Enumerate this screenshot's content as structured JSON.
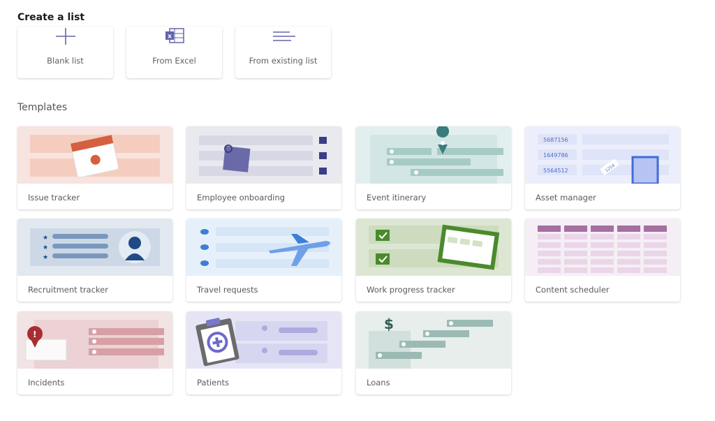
{
  "header": {
    "title": "Create a list"
  },
  "create_options": [
    {
      "label": "Blank list",
      "icon": "plus-icon"
    },
    {
      "label": "From Excel",
      "icon": "excel-icon"
    },
    {
      "label": "From existing list",
      "icon": "lines-icon"
    }
  ],
  "templates_heading": "Templates",
  "templates": [
    {
      "label": "Issue tracker",
      "color": "#f7e3df"
    },
    {
      "label": "Employee onboarding",
      "color": "#e9e9f0"
    },
    {
      "label": "Event itinerary",
      "color": "#e3efee"
    },
    {
      "label": "Asset manager",
      "color": "#eceffb"
    },
    {
      "label": "Recruitment tracker",
      "color": "#e2e8f0"
    },
    {
      "label": "Travel requests",
      "color": "#e6f0fa"
    },
    {
      "label": "Work progress tracker",
      "color": "#dde6d3"
    },
    {
      "label": "Content scheduler",
      "color": "#f6eef5"
    },
    {
      "label": "Incidents",
      "color": "#f2e3e5"
    },
    {
      "label": "Patients",
      "color": "#e6e5f6"
    },
    {
      "label": "Loans",
      "color": "#e7eeec"
    }
  ],
  "asset_ids": [
    "5687156",
    "1649786",
    "5564512"
  ],
  "asset_tag": "1254"
}
